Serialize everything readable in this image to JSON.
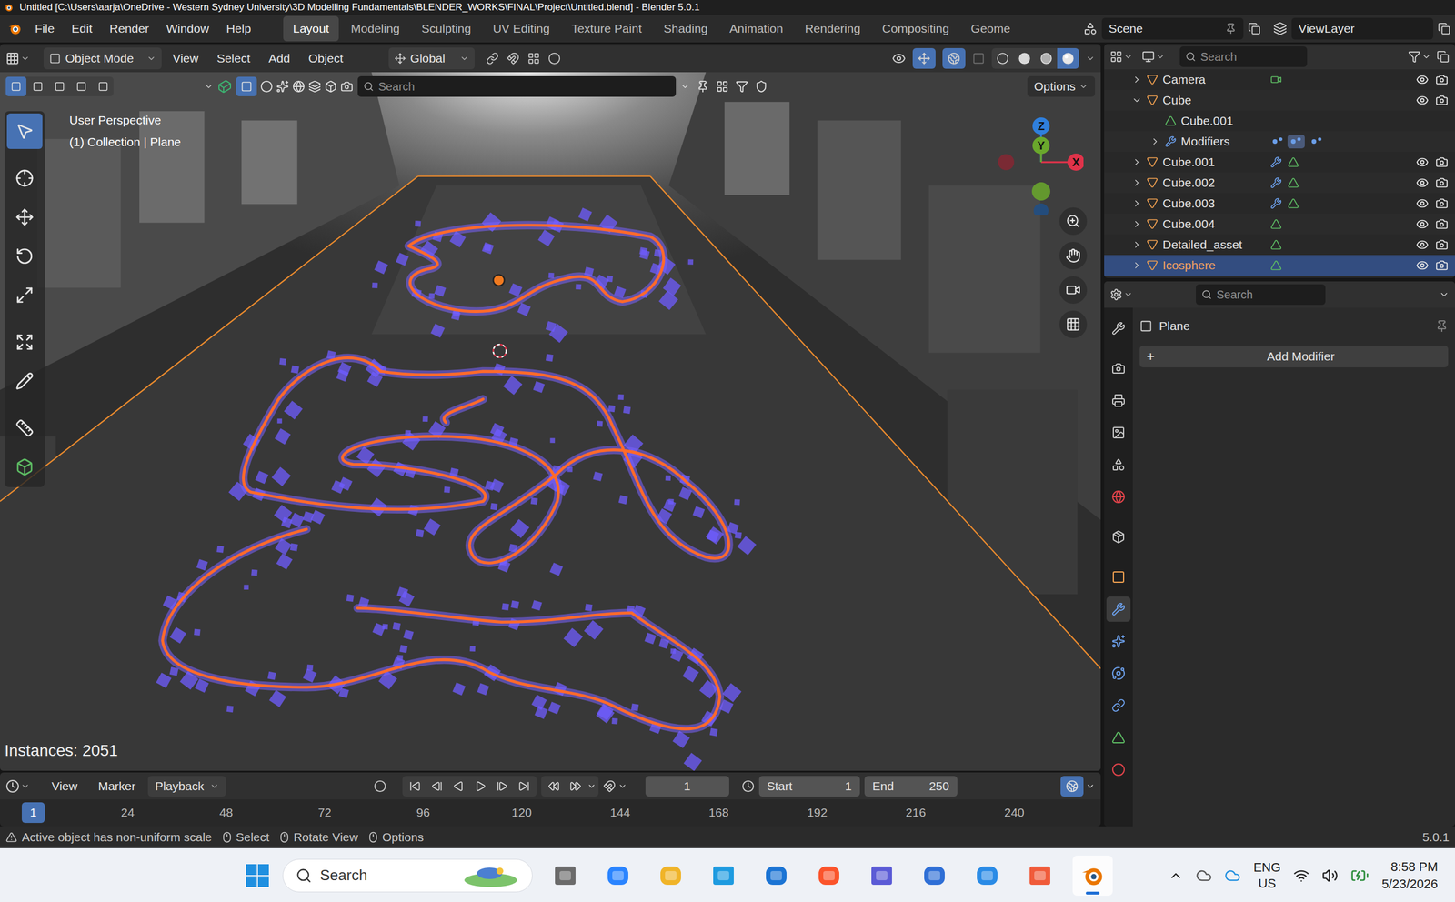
{
  "window": {
    "title": "Untitled [C:\\Users\\aarja\\OneDrive - Western Sydney University\\3D Modelling Fundamentals\\BLENDER_WORKS\\FINAL\\Project\\Untitled.blend] - Blender 5.0.1"
  },
  "menus": [
    "File",
    "Edit",
    "Render",
    "Window",
    "Help"
  ],
  "workspaces": [
    {
      "label": "Layout",
      "selected": true
    },
    {
      "label": "Modeling",
      "selected": false
    },
    {
      "label": "Sculpting",
      "selected": false
    },
    {
      "label": "UV Editing",
      "selected": false
    },
    {
      "label": "Texture Paint",
      "selected": false
    },
    {
      "label": "Shading",
      "selected": false
    },
    {
      "label": "Animation",
      "selected": false
    },
    {
      "label": "Rendering",
      "selected": false
    },
    {
      "label": "Compositing",
      "selected": false
    },
    {
      "label": "Geome",
      "selected": false
    }
  ],
  "scene": "Scene",
  "view_layer": "ViewLayer",
  "viewport": {
    "mode": "Object Mode",
    "menus": [
      "View",
      "Select",
      "Add",
      "Object"
    ],
    "orientation": "Global",
    "search_placeholder": "Search",
    "options": "Options",
    "view_name": "User Perspective",
    "context": "(1) Collection | Plane",
    "stats": "Instances: 2051",
    "gizmo": [
      {
        "label": "Z",
        "color": "#2f7fdc"
      },
      {
        "label": "Y",
        "color": "#6aa82c"
      },
      {
        "label": "X",
        "color": "#e0334a"
      }
    ],
    "tools": [
      {
        "selected": true
      },
      {
        "selected": false
      },
      {
        "selected": false
      },
      {
        "selected": false
      },
      {
        "selected": false
      },
      {
        "selected": false
      },
      {
        "selected": false
      },
      {
        "selected": false
      },
      {
        "selected": false
      }
    ],
    "shading": [
      {
        "selected": false
      },
      {
        "selected": false
      },
      {
        "selected": false
      },
      {
        "selected": true
      }
    ]
  },
  "outliner": {
    "search_placeholder": "Search",
    "rows": [
      {
        "name": "Camera",
        "kind": "object",
        "child": false,
        "expanded": false,
        "has_modifier": false,
        "data": "camera",
        "visible": true,
        "selected": false
      },
      {
        "name": "Cube",
        "kind": "object",
        "child": false,
        "expanded": true,
        "has_modifier": false,
        "data": "none",
        "visible": true,
        "selected": false
      },
      {
        "name": "Cube.001",
        "kind": "mesh",
        "child": true,
        "expanded": false,
        "has_modifier": false,
        "data": "none",
        "visible": false,
        "selected": false
      },
      {
        "name": "Modifiers",
        "kind": "modifiers",
        "child": true,
        "expanded": false,
        "has_modifier": false,
        "data": "none",
        "visible": false,
        "selected": false
      },
      {
        "name": "Cube.001",
        "kind": "object",
        "child": false,
        "expanded": false,
        "has_modifier": true,
        "data": "mesh",
        "visible": true,
        "selected": false
      },
      {
        "name": "Cube.002",
        "kind": "object",
        "child": false,
        "expanded": false,
        "has_modifier": true,
        "data": "mesh",
        "visible": true,
        "selected": false
      },
      {
        "name": "Cube.003",
        "kind": "object",
        "child": false,
        "expanded": false,
        "has_modifier": true,
        "data": "mesh",
        "visible": true,
        "selected": false
      },
      {
        "name": "Cube.004",
        "kind": "object",
        "child": false,
        "expanded": false,
        "has_modifier": false,
        "data": "mesh",
        "visible": true,
        "selected": false
      },
      {
        "name": "Detailed_asset",
        "kind": "object",
        "child": false,
        "expanded": false,
        "has_modifier": false,
        "data": "mesh",
        "visible": true,
        "selected": false
      },
      {
        "name": "Icosphere",
        "kind": "object",
        "child": false,
        "expanded": false,
        "has_modifier": false,
        "data": "mesh",
        "visible": true,
        "selected": true
      }
    ]
  },
  "properties": {
    "search_placeholder": "Search",
    "object": "Plane",
    "add_icon": "+",
    "add_modifier": "Add Modifier",
    "tabs": [
      {
        "selected": false
      },
      {
        "selected": false
      },
      {
        "selected": false
      },
      {
        "selected": false
      },
      {
        "selected": false
      },
      {
        "selected": false
      },
      {
        "selected": false
      },
      {
        "selected": false
      },
      {
        "selected": true
      },
      {
        "selected": false
      },
      {
        "selected": false
      },
      {
        "selected": false
      },
      {
        "selected": false
      },
      {
        "selected": false
      }
    ]
  },
  "timeline": {
    "menus": [
      "View",
      "Marker"
    ],
    "playback": "Playback",
    "frame": "1",
    "start_label": "Start",
    "start": "1",
    "end_label": "End",
    "end": "250",
    "ticks": [
      {
        "label": "1",
        "selected": true
      },
      {
        "label": "24",
        "selected": false
      },
      {
        "label": "48",
        "selected": false
      },
      {
        "label": "72",
        "selected": false
      },
      {
        "label": "96",
        "selected": false
      },
      {
        "label": "120",
        "selected": false
      },
      {
        "label": "144",
        "selected": false
      },
      {
        "label": "168",
        "selected": false
      },
      {
        "label": "192",
        "selected": false
      },
      {
        "label": "216",
        "selected": false
      },
      {
        "label": "240",
        "selected": false
      }
    ]
  },
  "status": {
    "message": "Active object has non-uniform scale",
    "hints": [
      "Select",
      "Rotate View",
      "Options"
    ],
    "version": "5.0.1"
  },
  "taskbar": {
    "search": "Search",
    "language": "ENG",
    "region": "US",
    "time": "8:58 PM",
    "date": "5/23/2026"
  }
}
